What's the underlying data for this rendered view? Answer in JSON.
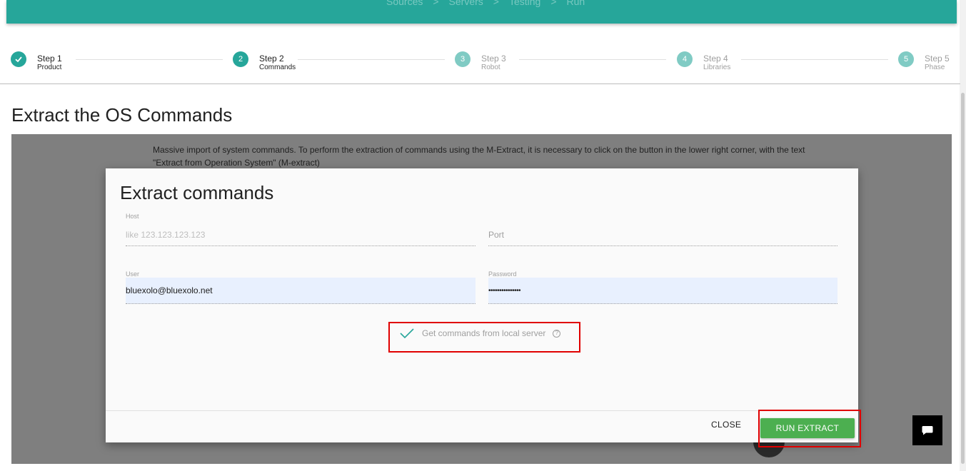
{
  "breadcrumbs": [
    "Sources",
    "Servers",
    "Testing",
    "Run"
  ],
  "breadcrumb_separator": ">",
  "steps": [
    {
      "number": "1",
      "title": "Step 1",
      "subtitle": "Product",
      "state": "done"
    },
    {
      "number": "2",
      "title": "Step 2",
      "subtitle": "Commands",
      "state": "active"
    },
    {
      "number": "3",
      "title": "Step 3",
      "subtitle": "Robot",
      "state": "inactive"
    },
    {
      "number": "4",
      "title": "Step 4",
      "subtitle": "Libraries",
      "state": "inactive"
    },
    {
      "number": "5",
      "title": "Step 5",
      "subtitle": "Phase",
      "state": "inactive"
    }
  ],
  "page": {
    "title": "Extract the OS Commands",
    "description": "Massive import of system commands. To perform the extraction of commands using the M-Extract, it is necessary to click on the button in the lower right corner, with the text \"Extract from Operation System\" (M-extract)"
  },
  "modal": {
    "title": "Extract commands",
    "host": {
      "label": "Host",
      "placeholder": "like 123.123.123.123",
      "value": ""
    },
    "port": {
      "placeholder": "Port",
      "value": ""
    },
    "user": {
      "label": "User",
      "value": "bluexolo@bluexolo.net"
    },
    "password": {
      "label": "Password",
      "value": "•••••••••••••••"
    },
    "local_server_checkbox": {
      "label": "Get commands from local server",
      "checked": true,
      "help_icon": "?"
    },
    "close_label": "CLOSE",
    "run_label": "RUN EXTRACT"
  },
  "colors": {
    "primary": "#26a69a",
    "success": "#4caf50",
    "highlight": "#e00000"
  },
  "icons": {
    "step_done": "check-icon",
    "checkbox": "checkmark-icon",
    "help": "help-circle-icon",
    "chat": "chat-bubble-icon"
  }
}
